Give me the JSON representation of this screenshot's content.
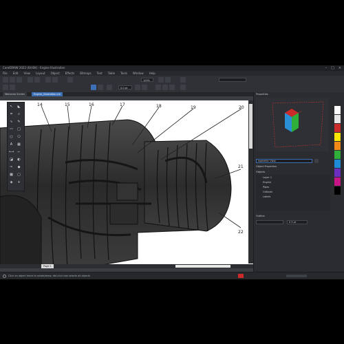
{
  "window": {
    "title": "CorelDRAW 2022 (64-Bit) - Engine Illustration"
  },
  "menu": {
    "items": [
      "File",
      "Edit",
      "View",
      "Layout",
      "Object",
      "Effects",
      "Bitmaps",
      "Text",
      "Table",
      "Tools",
      "Window",
      "Help"
    ]
  },
  "toolbar": {
    "zoom_value": "100%",
    "size_value": "0.0 pt"
  },
  "tabs": [
    {
      "label": "Welcome Screen"
    },
    {
      "label": "Engine_Illustration.cdr"
    }
  ],
  "callouts": [
    "14",
    "15",
    "16",
    "17",
    "18",
    "19",
    "20",
    "21",
    "22"
  ],
  "panel": {
    "header": "Properties",
    "view_field": "Isometric View",
    "section_label": "Object Properties",
    "list_header": "Objects",
    "list_items": [
      "Layer 1",
      "Engine",
      "Pipes",
      "Callouts",
      "Labels"
    ],
    "bottom_field": "Outline",
    "bottom_value": "0.5 pt"
  },
  "page_tab": {
    "label": "Page 1"
  },
  "status": {
    "message": "Click an object twice to rotate/skew; dbl-click tool selects all objects"
  },
  "colors": {
    "accent": "#3d6fb6",
    "cube_top": "#cc2b2b",
    "cube_left": "#2b8fd6",
    "cube_right": "#2fae3a"
  },
  "palette": [
    "#ffffff",
    "#e6e6e6",
    "#cc2b2b",
    "#ffe600",
    "#f28a1a",
    "#2fae3a",
    "#1e8bd6",
    "#6a2fbf",
    "#c71585",
    "#000000"
  ]
}
